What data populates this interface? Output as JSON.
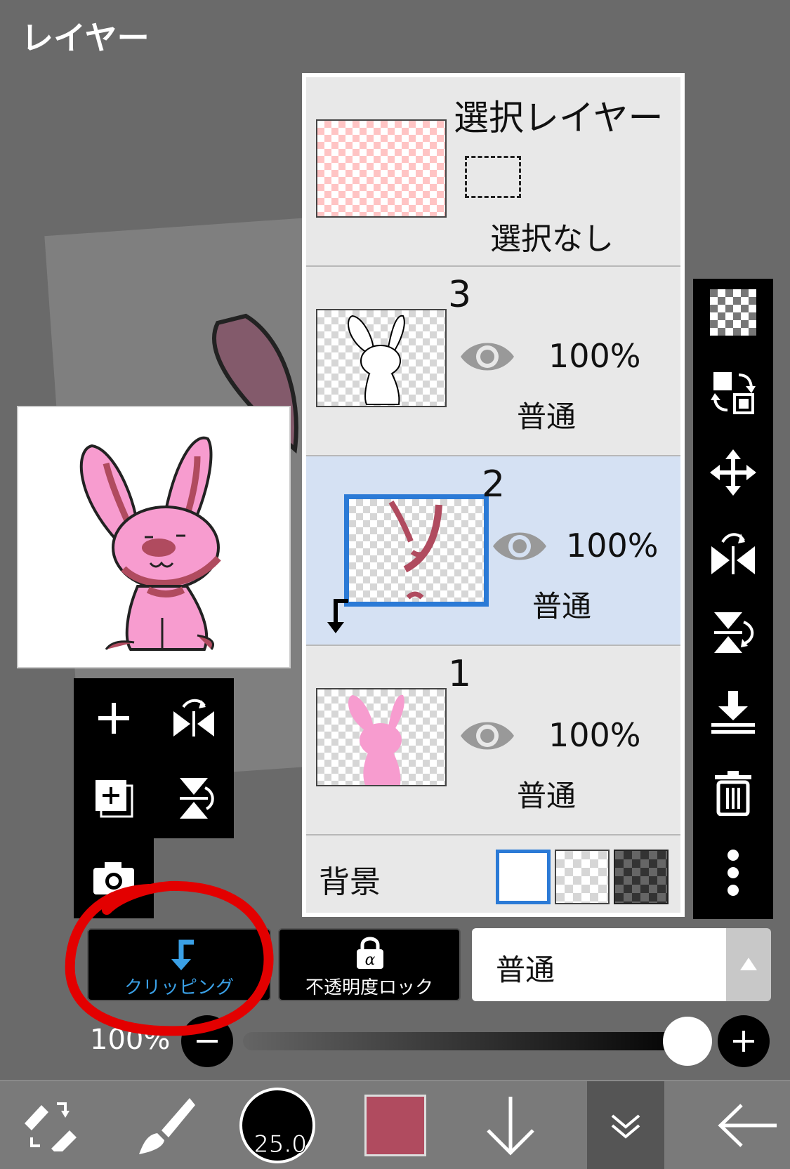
{
  "title": "レイヤー",
  "selection_layer": {
    "label": "選択レイヤー",
    "status": "選択なし"
  },
  "layers": [
    {
      "number": "3",
      "opacity": "100%",
      "blend": "普通"
    },
    {
      "number": "2",
      "opacity": "100%",
      "blend": "普通"
    },
    {
      "number": "1",
      "opacity": "100%",
      "blend": "普通"
    }
  ],
  "background": {
    "label": "背景"
  },
  "buttons": {
    "clipping": "クリッピング",
    "opacity_lock": "不透明度ロック",
    "blend_mode": "普通"
  },
  "opacity": {
    "label": "100%",
    "value": 1.0
  },
  "brush": {
    "size": "25.0",
    "color": "#b04b5f"
  },
  "colors": {
    "accent": "#2b7ad6",
    "clipping_blue": "#3aa0e6",
    "selected_row": "#d5e1f3",
    "annotation": "#e30000",
    "bunny_pink": "#f79ccf"
  },
  "icons": {
    "right_bar": [
      "transparency-icon",
      "swap-layer-icon",
      "move-icon",
      "flip-horizontal-icon",
      "flip-vertical-icon",
      "merge-down-icon",
      "trash-icon",
      "more-icon"
    ],
    "left_tools": [
      "add-layer-icon",
      "flip-horizontal-icon",
      "copy-layer-icon",
      "flip-vertical-icon",
      "camera-icon"
    ],
    "bottom_bar": [
      "transform-icon",
      "brush-icon",
      "brush-size-icon",
      "color-swatch",
      "arrow-down-icon",
      "collapse-icon",
      "back-arrow-icon"
    ]
  }
}
